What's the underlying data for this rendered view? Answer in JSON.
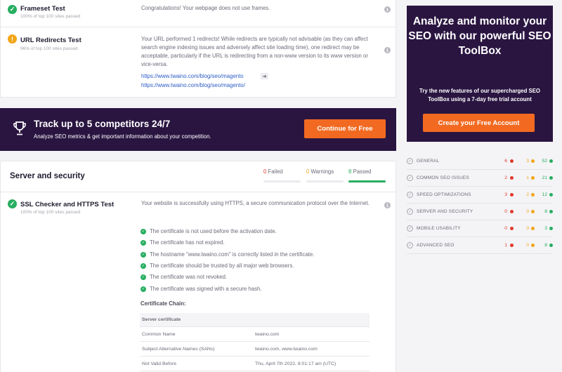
{
  "tests": {
    "frameset": {
      "name": "Frameset Test",
      "sub": "100% of top 100 sites passed",
      "desc": "Congratulations! Your webpage does not use frames."
    },
    "redirects": {
      "name": "URL Redirects Test",
      "sub": "96% of top 100 sites passed",
      "desc": "Your URL performed 1 redirects! While redirects are typically not advisable (as they can affect search engine indexing issues and adversely affect site loading time), one redirect may be acceptable, particularly if the URL is redirecting from a non-www version to its www version or vice-versa.",
      "link_from": "https://www.twaino.com/blog/seo/magento",
      "arrow": "➜",
      "link_to": "https://www.twaino.com/blog/seo/magento/"
    },
    "ssl": {
      "name": "SSL Checker and HTTPS Test",
      "sub": "100% of top 100 sites passed",
      "desc": "Your website is successfully using HTTPS, a secure communication protocol over the Internet.",
      "checks": [
        "The certificate is not used before the activation date.",
        "The certificate has not expired.",
        "The hostname \"www.twaino.com\" is correctly listed in the certificate.",
        "The certificate should be trusted by all major web browsers.",
        "The certificate was not revoked.",
        "The certificate was signed with a secure hash."
      ],
      "chain_title": "Certificate Chain:",
      "table_header": "Server certificate",
      "rows": [
        {
          "key": "Common Name",
          "value": "twaino.com"
        },
        {
          "key": "Subject Alternative Names (SANs)",
          "value": "twaino.com, www.twaino.com"
        },
        {
          "key": "Not Valid Before",
          "value": "Thu, April 7th 2022, 8:01:17 am (UTC)"
        }
      ]
    }
  },
  "banner": {
    "title": "Track up to 5 competitors 24/7",
    "sub": "Analyze SEO metrics & get important information about your competition.",
    "button": "Continue for Free"
  },
  "section": {
    "title": "Server and security",
    "failed_count": "0",
    "failed_label": "Failed",
    "warnings_count": "0",
    "warnings_label": "Warnings",
    "passed_count": "8",
    "passed_label": "Passed"
  },
  "promo": {
    "title": "Analyze and monitor your SEO with our powerful SEO ToolBox",
    "sub": "Try the new features of our supercharged SEO ToolBox using a 7-day free trial account",
    "button": "Create your Free Account"
  },
  "summary": [
    {
      "label": "GENERAL",
      "failed": "6",
      "warnings": "3",
      "passed": "52"
    },
    {
      "label": "COMMON SEO ISSUES",
      "failed": "2",
      "warnings": "1",
      "passed": "21"
    },
    {
      "label": "SPEED OPTIMIZATIONS",
      "failed": "3",
      "warnings": "2",
      "passed": "12"
    },
    {
      "label": "SERVER AND SECURITY",
      "failed": "0",
      "warnings": "0",
      "passed": "8"
    },
    {
      "label": "MOBILE USABILITY",
      "failed": "0",
      "warnings": "0",
      "passed": "3"
    },
    {
      "label": "ADVANCED SEO",
      "failed": "1",
      "warnings": "0",
      "passed": "8"
    }
  ],
  "colors": {
    "brand_dark": "#2a1541",
    "accent": "#f26a21",
    "pass": "#27ae60",
    "warn": "#f2a516",
    "fail": "#e0392b"
  }
}
